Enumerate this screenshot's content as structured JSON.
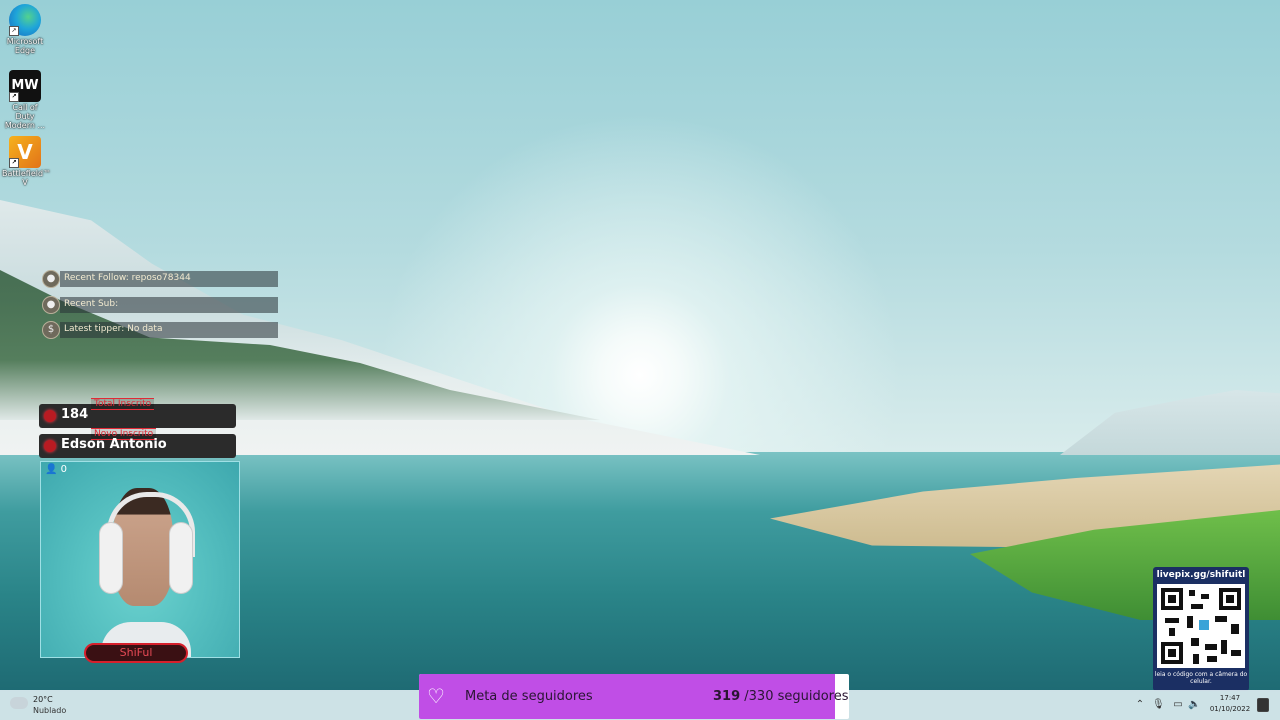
{
  "desktop_icons": [
    {
      "name": "Microsoft Edge",
      "label": "Microsoft Edge"
    },
    {
      "name": "Call of Duty Modern Warfare",
      "label": "Call of Duty Modern ..."
    },
    {
      "name": "Battlefield V",
      "label": "Battlefield™ V"
    }
  ],
  "alerts": {
    "recent_follow": "Recent Follow: reposo78344",
    "recent_sub": "Recent Sub:",
    "latest_tipper": "Latest tipper: No data"
  },
  "stats": {
    "total_label": "Total Inscrito",
    "total_value": "184",
    "new_label": "Novo Inscrito",
    "new_value": "Edson Antonio"
  },
  "webcam": {
    "viewer_count": "0",
    "name_plate": "ShiFul"
  },
  "qr": {
    "url": "livepix.gg/shifuitl",
    "caption": "leia o código com a câmera do celular."
  },
  "goal": {
    "label": "Meta de seguidores",
    "current": "319",
    "target_text": "/330 seguidores",
    "progress": 0.967,
    "color": "#c04ee6"
  },
  "taskbar": {
    "temperature": "20°C",
    "condition": "Nublado",
    "time": "17:47",
    "date": "01/10/2022",
    "tray_icons": [
      "chevron-up-icon",
      "microphone-icon",
      "network-icon",
      "volume-icon",
      "keyboard-icon"
    ]
  }
}
